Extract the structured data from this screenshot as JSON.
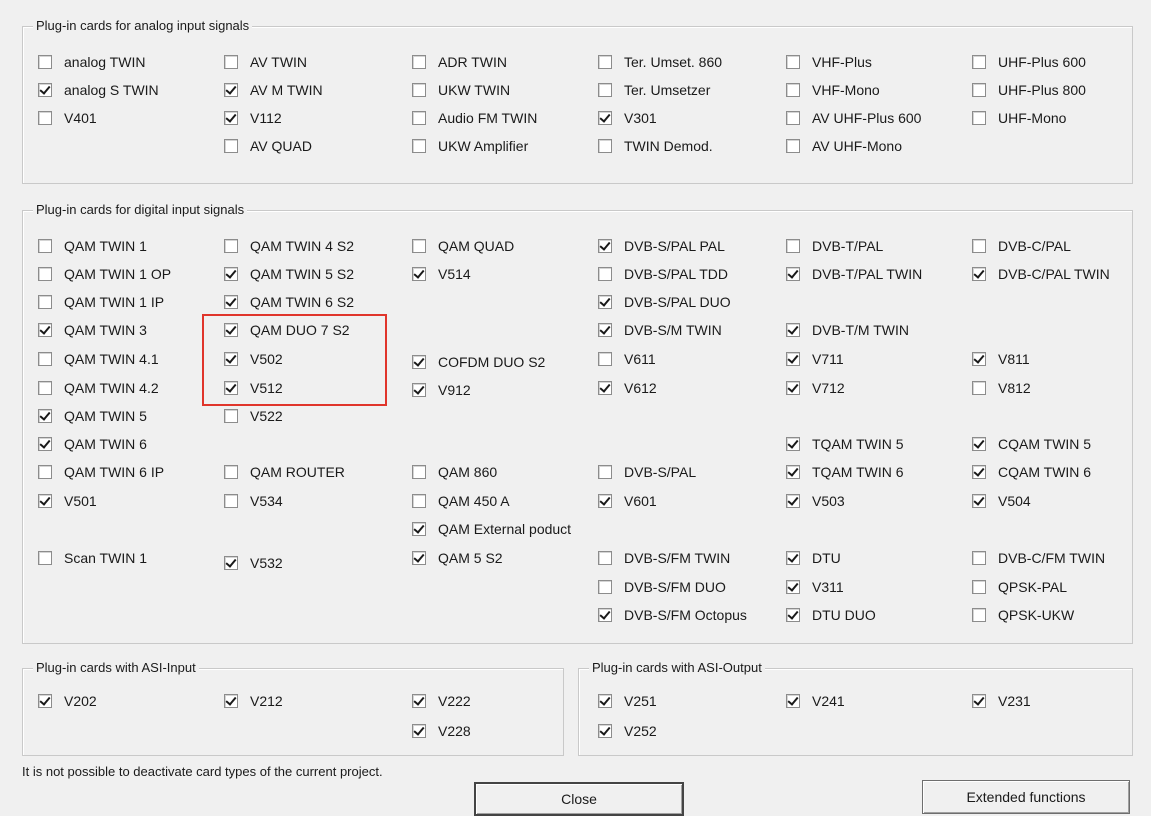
{
  "groups": {
    "analog": "Plug-in cards for analog input signals",
    "digital": "Plug-in cards for digital input signals",
    "asi_input": "Plug-in cards with ASI-Input",
    "asi_output": "Plug-in cards with ASI-Output"
  },
  "checkboxes": [
    {
      "label": "analog TWIN",
      "checked": false
    },
    {
      "label": "analog S TWIN",
      "checked": true
    },
    {
      "label": "V401",
      "checked": false
    },
    {
      "label": "AV TWIN",
      "checked": false
    },
    {
      "label": "AV M TWIN",
      "checked": true
    },
    {
      "label": "V112",
      "checked": true
    },
    {
      "label": "AV QUAD",
      "checked": false
    },
    {
      "label": "ADR TWIN",
      "checked": false
    },
    {
      "label": "UKW TWIN",
      "checked": false
    },
    {
      "label": "Audio FM TWIN",
      "checked": false
    },
    {
      "label": "UKW Amplifier",
      "checked": false
    },
    {
      "label": "Ter. Umset. 860",
      "checked": false
    },
    {
      "label": "Ter. Umsetzer",
      "checked": false
    },
    {
      "label": "V301",
      "checked": true
    },
    {
      "label": "TWIN Demod.",
      "checked": false
    },
    {
      "label": "VHF-Plus",
      "checked": false
    },
    {
      "label": "VHF-Mono",
      "checked": false
    },
    {
      "label": "AV UHF-Plus 600",
      "checked": false
    },
    {
      "label": "AV UHF-Mono",
      "checked": false
    },
    {
      "label": "UHF-Plus 600",
      "checked": false
    },
    {
      "label": "UHF-Plus 800",
      "checked": false
    },
    {
      "label": "UHF-Mono",
      "checked": false
    },
    {
      "label": "QAM TWIN 1",
      "checked": false
    },
    {
      "label": "QAM TWIN 1 OP",
      "checked": false
    },
    {
      "label": "QAM TWIN 1 IP",
      "checked": false
    },
    {
      "label": "QAM TWIN 3",
      "checked": true
    },
    {
      "label": "QAM TWIN 4.1",
      "checked": false
    },
    {
      "label": "QAM TWIN 4.2",
      "checked": false
    },
    {
      "label": "QAM TWIN 5",
      "checked": true
    },
    {
      "label": "QAM TWIN 6",
      "checked": true
    },
    {
      "label": "QAM TWIN 6 IP",
      "checked": false
    },
    {
      "label": "V501",
      "checked": true
    },
    {
      "label": "Scan TWIN 1",
      "checked": false
    },
    {
      "label": "QAM TWIN 4 S2",
      "checked": false
    },
    {
      "label": "QAM TWIN 5 S2",
      "checked": true
    },
    {
      "label": "QAM TWIN 6 S2",
      "checked": true
    },
    {
      "label": "QAM DUO 7 S2",
      "checked": true
    },
    {
      "label": "V502",
      "checked": true
    },
    {
      "label": "V512",
      "checked": true
    },
    {
      "label": "V522",
      "checked": false
    },
    {
      "label": "QAM ROUTER",
      "checked": false
    },
    {
      "label": "V534",
      "checked": false
    },
    {
      "label": "V532",
      "checked": true
    },
    {
      "label": "QAM QUAD",
      "checked": false
    },
    {
      "label": "V514",
      "checked": true
    },
    {
      "label": "COFDM DUO S2",
      "checked": true
    },
    {
      "label": "V912",
      "checked": true
    },
    {
      "label": "QAM 860",
      "checked": false
    },
    {
      "label": "QAM 450 A",
      "checked": false
    },
    {
      "label": "QAM External poduct",
      "checked": true
    },
    {
      "label": "QAM 5 S2",
      "checked": true
    },
    {
      "label": "DVB-S/PAL PAL",
      "checked": true
    },
    {
      "label": "DVB-S/PAL TDD",
      "checked": false
    },
    {
      "label": "DVB-S/PAL DUO",
      "checked": true
    },
    {
      "label": "DVB-S/M TWIN",
      "checked": true
    },
    {
      "label": "V611",
      "checked": false
    },
    {
      "label": "V612",
      "checked": true
    },
    {
      "label": "DVB-S/PAL",
      "checked": false
    },
    {
      "label": "V601",
      "checked": true
    },
    {
      "label": "DVB-S/FM TWIN",
      "checked": false
    },
    {
      "label": "DVB-S/FM DUO",
      "checked": false
    },
    {
      "label": "DVB-S/FM Octopus",
      "checked": true
    },
    {
      "label": "DVB-T/PAL",
      "checked": false
    },
    {
      "label": "DVB-T/PAL TWIN",
      "checked": true
    },
    {
      "label": "DVB-T/M TWIN",
      "checked": true
    },
    {
      "label": "V711",
      "checked": true
    },
    {
      "label": "V712",
      "checked": true
    },
    {
      "label": "TQAM TWIN 5",
      "checked": true
    },
    {
      "label": "TQAM TWIN 6",
      "checked": true
    },
    {
      "label": "V503",
      "checked": true
    },
    {
      "label": "DTU",
      "checked": true
    },
    {
      "label": "V311",
      "checked": true
    },
    {
      "label": "DTU DUO",
      "checked": true
    },
    {
      "label": "DVB-C/PAL",
      "checked": false
    },
    {
      "label": "DVB-C/PAL TWIN",
      "checked": true
    },
    {
      "label": "V811",
      "checked": true
    },
    {
      "label": "V812",
      "checked": false
    },
    {
      "label": "CQAM TWIN 5",
      "checked": true
    },
    {
      "label": "CQAM TWIN 6",
      "checked": true
    },
    {
      "label": "V504",
      "checked": true
    },
    {
      "label": "DVB-C/FM TWIN",
      "checked": false
    },
    {
      "label": "QPSK-PAL",
      "checked": false
    },
    {
      "label": "QPSK-UKW",
      "checked": false
    },
    {
      "label": "V202",
      "checked": true
    },
    {
      "label": "V212",
      "checked": true
    },
    {
      "label": "V222",
      "checked": true
    },
    {
      "label": "V228",
      "checked": true
    },
    {
      "label": "V251",
      "checked": true
    },
    {
      "label": "V252",
      "checked": true
    },
    {
      "label": "V241",
      "checked": true
    },
    {
      "label": "V231",
      "checked": true
    }
  ],
  "footer": {
    "note": "It is not possible to deactivate card types of the current project.",
    "close_label": "Close",
    "extended_label": "Extended functions"
  },
  "colors": {
    "background": "#f0f0f0",
    "highlight": "#e0352b"
  }
}
